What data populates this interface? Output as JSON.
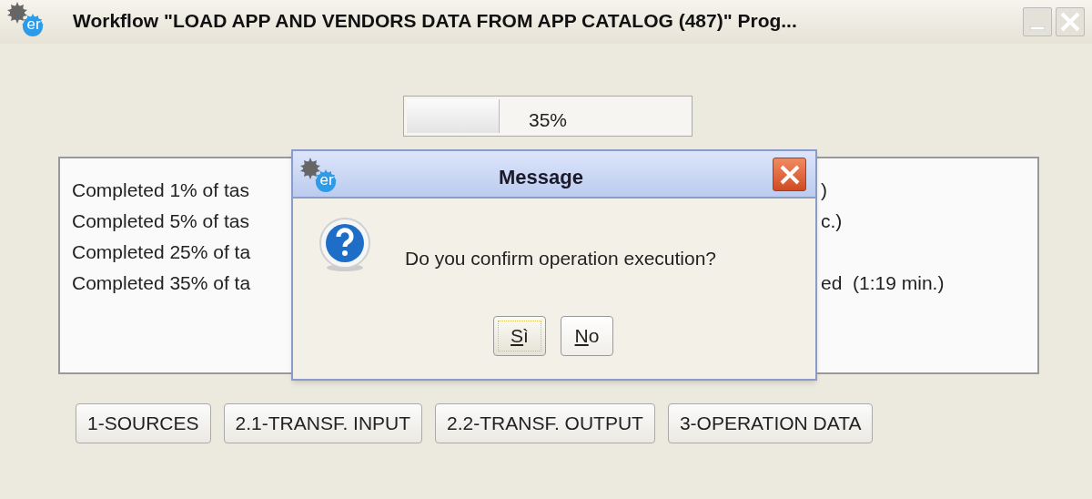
{
  "window": {
    "title": "Workflow \"LOAD APP AND VENDORS DATA FROM APP CATALOG (487)\" Prog...",
    "logo_text": "er"
  },
  "progress": {
    "level": 0.33,
    "text": "35%"
  },
  "log_lines": [
    {
      "visible_start": "Completed 1% of tas",
      "visible_end": ")"
    },
    {
      "visible_start": "Completed 5% of tas",
      "visible_end": "c.)"
    },
    {
      "visible_start": "Completed 25% of ta"
    },
    {
      "visible_start": "Completed 35% of ta",
      "visible_end": "ed  (1:19 min.)"
    }
  ],
  "buttons": [
    "1-SOURCES",
    "2.1-TRANSF. INPUT",
    "2.2-TRANSF. OUTPUT",
    "3-OPERATION DATA"
  ],
  "dialog": {
    "title": "Message",
    "logo_text": "er",
    "message": "Do you confirm operation execution?",
    "buttons": [
      {
        "label": "Sì",
        "focused": true,
        "underline_first": true
      },
      {
        "label": "No",
        "focused": false,
        "underline_first": true
      }
    ]
  }
}
